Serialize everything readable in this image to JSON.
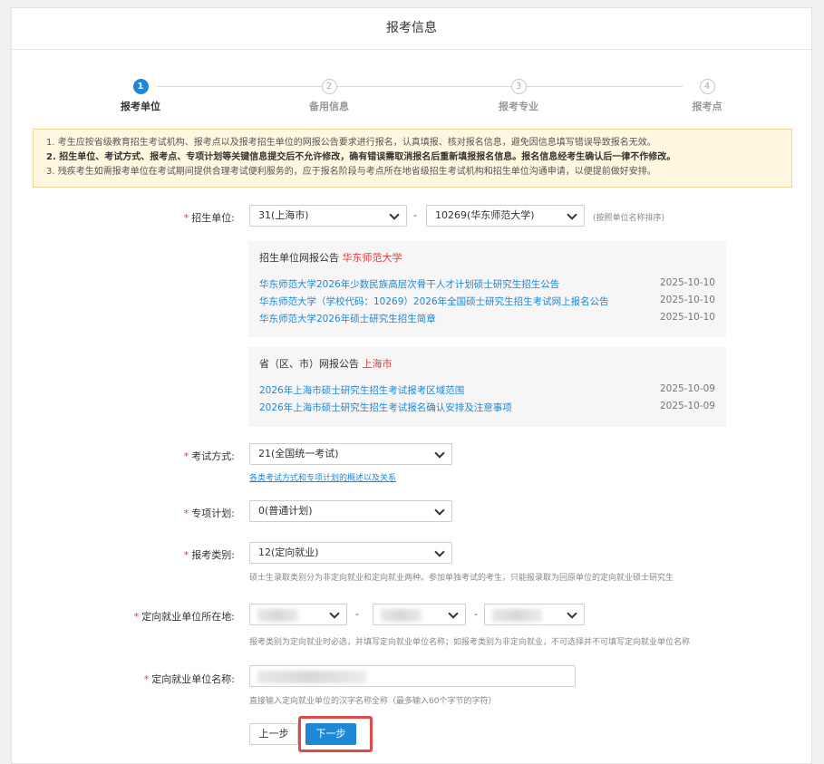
{
  "header": {
    "title": "报考信息"
  },
  "steps": [
    {
      "num": "1",
      "label": "报考单位"
    },
    {
      "num": "2",
      "label": "备用信息"
    },
    {
      "num": "3",
      "label": "报考专业"
    },
    {
      "num": "4",
      "label": "报考点"
    }
  ],
  "notice": {
    "line1": "1. 考生应按省级教育招生考试机构、报考点以及报考招生单位的网报公告要求进行报名，认真填报、核对报名信息，避免因信息填写错误导致报名无效。",
    "line2": "2. 招生单位、考试方式、报考点、专项计划等关键信息提交后不允许修改，确有错误需取消报名后重新填报报名信息。报名信息经考生确认后一律不作修改。",
    "line3": "3. 残疾考生如需报考单位在考试期间提供合理考试便利服务的，应于报名阶段与考点所在地省级招生考试机构和招生单位沟通申请，以便提前做好安排。"
  },
  "form": {
    "unit_label": "招生单位:",
    "unit_province": "31(上海市)",
    "unit_school": "10269(华东师范大学)",
    "unit_hint": "(按照单位名称排序)",
    "school_box": {
      "title": "招生单位网报公告",
      "name": "华东师范大学",
      "items": [
        {
          "text": "华东师范大学2026年少数民族高层次骨干人才计划硕士研究生招生公告",
          "date": "2025-10-10"
        },
        {
          "text": "华东师范大学（学校代码：10269）2026年全国硕士研究生招生考试网上报名公告",
          "date": "2025-10-10"
        },
        {
          "text": "华东师范大学2026年硕士研究生招生简章",
          "date": "2025-10-10"
        }
      ]
    },
    "province_box": {
      "title": "省（区、市）网报公告",
      "name": "上海市",
      "items": [
        {
          "text": "2026年上海市硕士研究生招生考试报考区域范围",
          "date": "2025-10-09"
        },
        {
          "text": "2026年上海市硕士研究生招生考试报名确认安排及注意事项",
          "date": "2025-10-09"
        }
      ]
    },
    "exam_label": "考试方式:",
    "exam_value": "21(全国统一考试)",
    "exam_hint": "各类考试方式和专项计划的概述以及关系",
    "plan_label": "专项计划:",
    "plan_value": "0(普通计划)",
    "category_label": "报考类别:",
    "category_value": "12(定向就业)",
    "category_hint": "硕士生录取类别分为非定向就业和定向就业两种。参加单独考试的考生，只能报录取为回原单位的定向就业硕士研究生",
    "location_label": "定向就业单位所在地:",
    "location_hint": "报考类别为定向就业时必选，并填写定向就业单位名称；如报考类别为非定向就业，不可选择并不可填写定向就业单位名称",
    "unitname_label": "定向就业单位名称:",
    "unitname_hint": "直接输入定向就业单位的汉字名称全称（最多输入60个字节的字符）"
  },
  "buttons": {
    "prev": "上一步",
    "next": "下一步"
  },
  "colors": {
    "accent": "#1e87d6",
    "required": "#e4393c",
    "highlight": "#e04a4a"
  }
}
